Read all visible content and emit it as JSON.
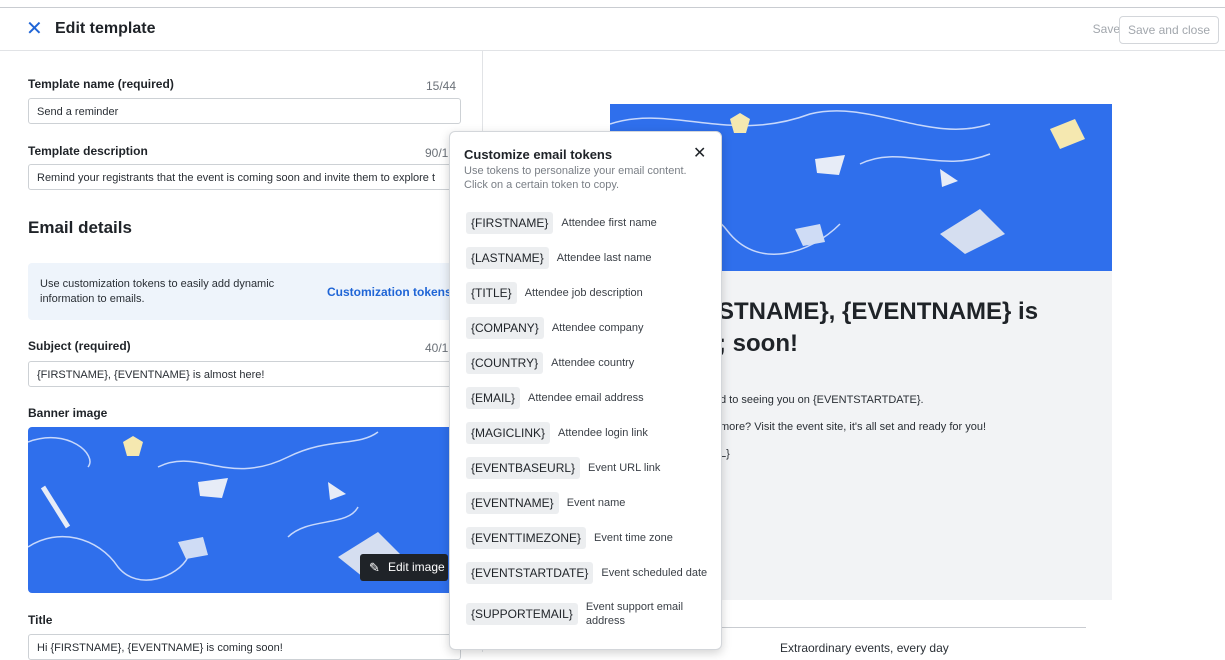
{
  "header": {
    "title": "Edit template",
    "save_label": "Save",
    "save_close_label": "Save and close"
  },
  "form": {
    "template_name": {
      "label": "Template name (required)",
      "counter": "15/44",
      "value": "Send a reminder"
    },
    "template_description": {
      "label": "Template description",
      "counter": "90/1",
      "value": "Remind your registrants that the event is coming soon and invite them to explore t"
    },
    "email_details_title": "Email details",
    "info": {
      "text": "Use customization tokens to easily add dynamic information to emails.",
      "link": "Customization tokens"
    },
    "subject": {
      "label": "Subject (required)",
      "counter": "40/1",
      "value": "{FIRSTNAME}, {EVENTNAME} is almost here!"
    },
    "banner": {
      "label": "Banner image",
      "edit_label": "Edit image"
    },
    "title": {
      "label": "Title",
      "value": "Hi {FIRSTNAME}, {EVENTNAME} is coming soon!"
    }
  },
  "preview": {
    "heading_line1": "STNAME}, {EVENTNAME} is",
    "heading_line2": "; soon!",
    "body_line1": "d to seeing you on {EVENTSTARTDATE}.",
    "body_line2": "more? Visit the event site, it's all set and ready for you!",
    "body_line3": "L}",
    "footer": "Extraordinary events, every day"
  },
  "popover": {
    "title": "Customize email tokens",
    "description": "Use tokens to personalize your email content. Click on a certain token to copy.",
    "tokens": [
      {
        "token": "{FIRSTNAME}",
        "desc": "Attendee first name"
      },
      {
        "token": "{LASTNAME}",
        "desc": "Attendee last name"
      },
      {
        "token": "{TITLE}",
        "desc": "Attendee job description"
      },
      {
        "token": "{COMPANY}",
        "desc": "Attendee company"
      },
      {
        "token": "{COUNTRY}",
        "desc": "Attendee country"
      },
      {
        "token": "{EMAIL}",
        "desc": "Attendee email address"
      },
      {
        "token": "{MAGICLINK}",
        "desc": "Attendee login link"
      },
      {
        "token": "{EVENTBASEURL}",
        "desc": "Event URL link"
      },
      {
        "token": "{EVENTNAME}",
        "desc": "Event name"
      },
      {
        "token": "{EVENTTIMEZONE}",
        "desc": "Event time zone"
      },
      {
        "token": "{EVENTSTARTDATE}",
        "desc": "Event scheduled date"
      },
      {
        "token": "{SUPPORTEMAIL}",
        "desc": "Event support email address"
      }
    ]
  },
  "colors": {
    "accent": "#1f65d6",
    "banner": "#2f6fec",
    "info_bg": "#eef4fb"
  },
  "icons": {
    "close": "close-icon",
    "popover_close": "close-icon",
    "edit": "pencil-icon"
  }
}
